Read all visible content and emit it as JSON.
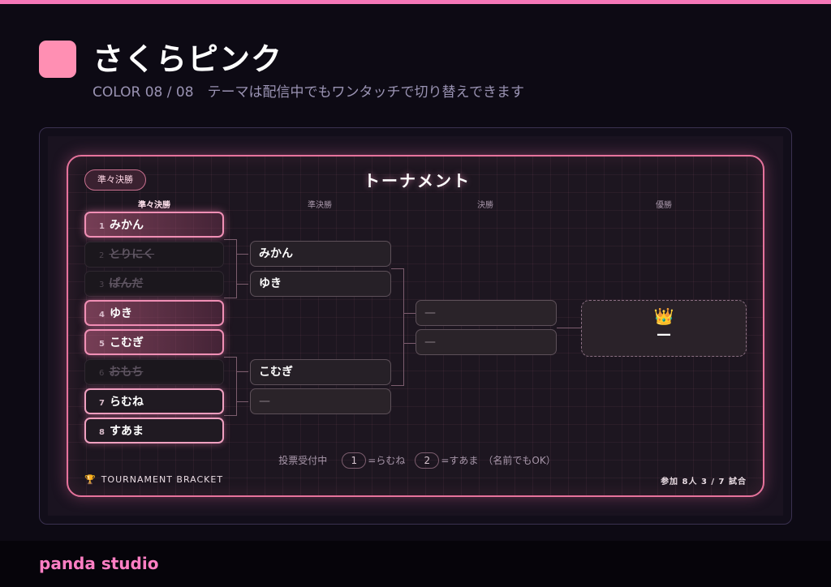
{
  "theme": {
    "title": "さくらピンク",
    "subtitle": "COLOR 08 / 08　テーマは配信中でもワンタッチで切り替えできます",
    "swatch_color": "#ff8fb3",
    "accent_color": "#f477b8"
  },
  "bracket": {
    "current_round_badge": "準々決勝",
    "title": "トーナメント",
    "columns": [
      "準々決勝",
      "準決勝",
      "決勝",
      "優勝"
    ],
    "quarterfinals": [
      {
        "seed": "1",
        "name": "みかん",
        "status": "winner"
      },
      {
        "seed": "2",
        "name": "とりにく",
        "status": "eliminated"
      },
      {
        "seed": "3",
        "name": "ぱんだ",
        "status": "eliminated"
      },
      {
        "seed": "4",
        "name": "ゆき",
        "status": "winner"
      },
      {
        "seed": "5",
        "name": "こむぎ",
        "status": "winner"
      },
      {
        "seed": "6",
        "name": "おもち",
        "status": "eliminated"
      },
      {
        "seed": "7",
        "name": "らむね",
        "status": "active"
      },
      {
        "seed": "8",
        "name": "すあま",
        "status": "active"
      }
    ],
    "semifinals": [
      "みかん",
      "ゆき",
      "こむぎ",
      "—"
    ],
    "finals": [
      "—",
      "—"
    ],
    "champion": {
      "icon": "crown-icon",
      "glyph": "👑",
      "name": "—"
    },
    "vote": {
      "label": "投票受付中",
      "options": [
        {
          "key": "1",
          "text": "=らむね"
        },
        {
          "key": "2",
          "text": "=すあま"
        }
      ],
      "note": "（名前でもOK）"
    },
    "brand_label": "TOURNAMENT BRACKET",
    "trophy_icon": "🏆",
    "stats": "参加 8人 3 / 7 試合"
  },
  "footer": {
    "brand": "panda studio"
  }
}
